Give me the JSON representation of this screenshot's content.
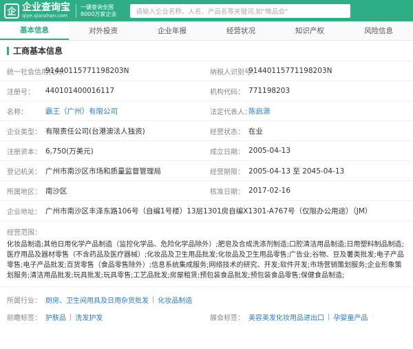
{
  "header": {
    "logo_mark": "企",
    "logo_name": "企业查询宝",
    "logo_url": "qiye.qianzhan.com",
    "slogan_line1": "一键查询全国",
    "slogan_line2": "8000万家企业",
    "search_placeholder": "请输入企业名称、人名、产品名等关键词,如\"唯品会\""
  },
  "tabs": [
    "基本信息",
    "对外投资",
    "企业年报",
    "经营状况",
    "知识产权",
    "风险信息"
  ],
  "section_title": "工商基本信息",
  "fields": {
    "credit_code_label": "统一社会信用代码：",
    "credit_code": "91440115771198203N",
    "taxpayer_label": "纳税人识别号：",
    "taxpayer": "91440115771198203N",
    "reg_no_label": "注册号：",
    "reg_no": "440101400016117",
    "org_code_label": "机构代码：",
    "org_code": "771198203",
    "name_label": "名称：",
    "name": "霸王（广州）有限公司",
    "legal_rep_label": "法定代表人：",
    "legal_rep": "陈启源",
    "type_label": "企业类型：",
    "type": "有限责任公司(台港澳法人独资)",
    "status_label": "经营状态：",
    "status": "在业",
    "capital_label": "注册资本：",
    "capital": "6,750(万美元)",
    "founded_label": "成立日期：",
    "founded": "2005-04-13",
    "authority_label": "登记机关：",
    "authority": "广州市南沙区市场和质量监督管理局",
    "term_label": "经营期限：",
    "term": "2005-04-13 至 2045-04-13",
    "region_label": "所属地区：",
    "region": "南沙区",
    "approved_label": "核准日期：",
    "approved": "2017-02-16",
    "address_label": "企业地址：",
    "address": "广州市南沙区丰泽东路106号（自编1号楼）13层1301房自编X1301-A767号（仅限办公用途）（JM）",
    "scope_label": "经营范围：",
    "scope": "化妆品制造;其他日用化学产品制造（监控化学品、危险化学品除外）;肥皂及合成洗涤剂制造;口腔清洁用品制造;日用塑料制品制造;医疗用品及器材零售（不含药品及医疗器械）;化妆品及卫生用品批发;化妆品及卫生用品零售;广告业;谷物、豆及薯类批发;电子产品零售;电子产品批发;百货零售（食品零售除外）;信息系统集成服务;网络技术的研究、开发;软件开发;市场营销策划服务;企业形象策划服务;清洁用品批发;玩具批发;玩具零售;工艺品批发;房屋租赁;预包装食品批发;预包装食品零售;保健食品制造;"
  },
  "industry": {
    "label": "所属行业：",
    "tags": [
      "厨房、卫生间用具及日用杂货批发",
      "化妆品制造"
    ]
  },
  "frontier": {
    "label": "前瞻标签：",
    "tags": [
      "护肤品",
      "洗发护发"
    ]
  },
  "exhibition": {
    "label": "展会标签：",
    "tags": [
      "美容美发化妆用品进出口",
      "孕婴童产品"
    ]
  },
  "colors": {
    "brand": "#2eae84",
    "link": "#2e7dc6"
  }
}
